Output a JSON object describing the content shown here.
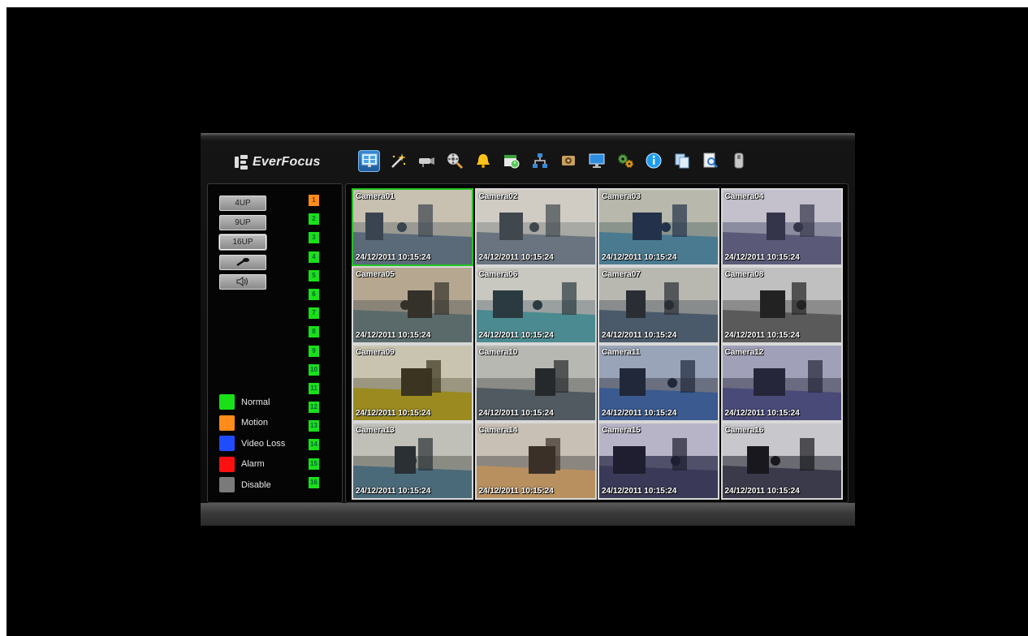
{
  "brand": {
    "name": "EverFocus"
  },
  "toolbar": [
    {
      "id": "live",
      "icon": "monitor-icon",
      "active": true
    },
    {
      "id": "wizard",
      "icon": "magic-wand-icon"
    },
    {
      "id": "camera",
      "icon": "camera-icon"
    },
    {
      "id": "playback",
      "icon": "film-search-icon"
    },
    {
      "id": "alarm",
      "icon": "bell-icon"
    },
    {
      "id": "schedule",
      "icon": "calendar-clock-icon"
    },
    {
      "id": "network",
      "icon": "network-icon"
    },
    {
      "id": "record",
      "icon": "record-icon"
    },
    {
      "id": "display",
      "icon": "display-icon"
    },
    {
      "id": "system",
      "icon": "gears-icon"
    },
    {
      "id": "info",
      "icon": "info-icon"
    },
    {
      "id": "copy",
      "icon": "copy-icon"
    },
    {
      "id": "search",
      "icon": "document-search-icon"
    },
    {
      "id": "storage",
      "icon": "hard-drive-icon"
    }
  ],
  "layout_buttons": [
    "4UP",
    "9UP",
    "16UP"
  ],
  "channels": [
    "1",
    "2",
    "3",
    "4",
    "5",
    "6",
    "7",
    "8",
    "9",
    "10",
    "11",
    "12",
    "13",
    "14",
    "15",
    "16"
  ],
  "channel_status": [
    "motion",
    "normal",
    "normal",
    "normal",
    "normal",
    "normal",
    "normal",
    "normal",
    "normal",
    "normal",
    "normal",
    "normal",
    "normal",
    "normal",
    "normal",
    "normal"
  ],
  "legend": [
    {
      "label": "Normal",
      "color": "#19e019"
    },
    {
      "label": "Motion",
      "color": "#ff8c1a"
    },
    {
      "label": "Video Loss",
      "color": "#1f4cff"
    },
    {
      "label": "Alarm",
      "color": "#ff1010"
    },
    {
      "label": "Disable",
      "color": "#7a7a7a"
    }
  ],
  "cameras": [
    {
      "name": "Camera01",
      "time": "24/12/2011 10:15:24"
    },
    {
      "name": "Camera02",
      "time": "24/12/2011 10:15:24"
    },
    {
      "name": "Camera03",
      "time": "24/12/2011 10:15:24"
    },
    {
      "name": "Camera04",
      "time": "24/12/2011 10:15:24"
    },
    {
      "name": "Camera05",
      "time": "24/12/2011 10:15:24"
    },
    {
      "name": "Camera06",
      "time": "24/12/2011 10:15:24"
    },
    {
      "name": "Camera07",
      "time": "24/12/2011 10:15:24"
    },
    {
      "name": "Camera08",
      "time": "24/12/2011 10:15:24"
    },
    {
      "name": "Camera09",
      "time": "24/12/2011 10:15:24"
    },
    {
      "name": "Camera10",
      "time": "24/12/2011 10:15:24"
    },
    {
      "name": "Camera11",
      "time": "24/12/2011 10:15:24"
    },
    {
      "name": "Camera12",
      "time": "24/12/2011 10:15:24"
    },
    {
      "name": "Camera13",
      "time": "24/12/2011 10:15:24"
    },
    {
      "name": "Camera14",
      "time": "24/12/2011 10:15:24"
    },
    {
      "name": "Camera15",
      "time": "24/12/2011 10:15:24"
    },
    {
      "name": "Camera16",
      "time": "24/12/2011 10:15:24"
    }
  ],
  "selected_camera": "Camera01"
}
